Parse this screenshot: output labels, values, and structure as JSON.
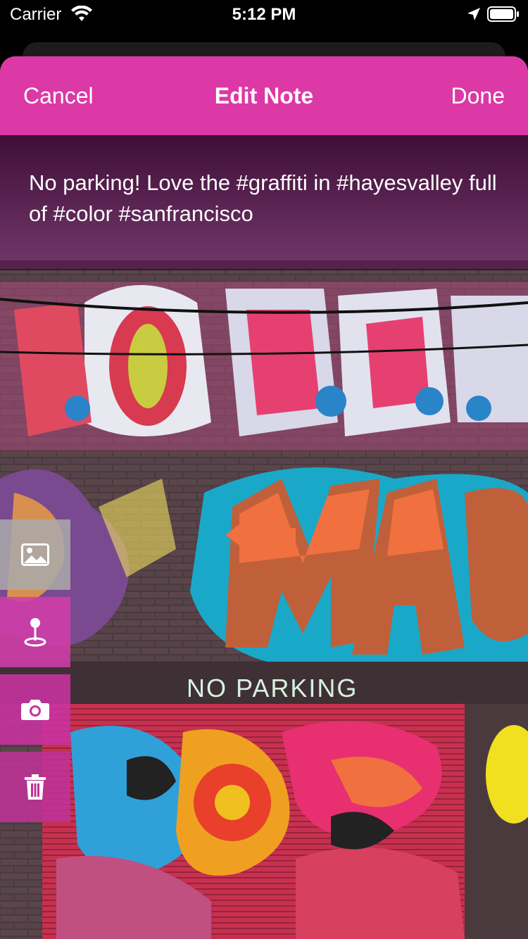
{
  "status_bar": {
    "carrier": "Carrier",
    "time": "5:12 PM"
  },
  "navbar": {
    "cancel_label": "Cancel",
    "title": "Edit Note",
    "done_label": "Done"
  },
  "note": {
    "text": "No parking! Love the #graffiti in #hayesvalley full of #color #sanfrancisco"
  },
  "photo": {
    "sign_text": "NO PARKING"
  },
  "tools": [
    {
      "icon": "image-icon"
    },
    {
      "icon": "location-pin-icon"
    },
    {
      "icon": "camera-icon"
    },
    {
      "icon": "trash-icon"
    }
  ],
  "colors": {
    "accent": "#dc38a6",
    "overlay": "#5a1450"
  }
}
